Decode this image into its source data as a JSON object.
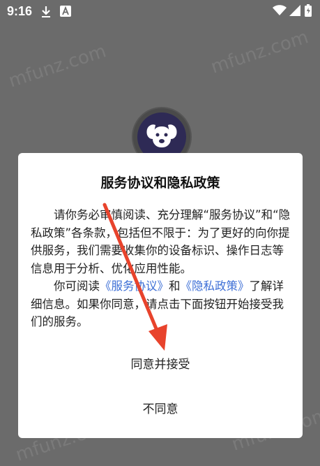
{
  "status_bar": {
    "time": "9:16",
    "icons": [
      "download-icon",
      "text-a-icon",
      "wifi-icon",
      "signal-icon",
      "battery-icon"
    ]
  },
  "background": {
    "watermark": "mfunz.com"
  },
  "dialog": {
    "title": "服务协议和隐私政策",
    "p1": "请你务必审慎阅读、充分理解“服务协议”和“隐私政策”各条款，包括但不限于：为了更好的向你提供服务，我们需要收集你的设备标识、操作日志等信息用于分析、优化应用性能。",
    "p2_pre": "你可阅读",
    "p2_link1": "《服务协议》",
    "p2_mid": "和",
    "p2_link2": "《隐私政策》",
    "p2_post": "了解详细信息。如果你同意，请点击下面按钮开始接受我们的服务。",
    "accept_label": "同意并接受",
    "decline_label": "不同意"
  },
  "colors": {
    "overlay": "#6b6b6b",
    "link": "#3d6fd6",
    "arrow": "#e8432c"
  }
}
